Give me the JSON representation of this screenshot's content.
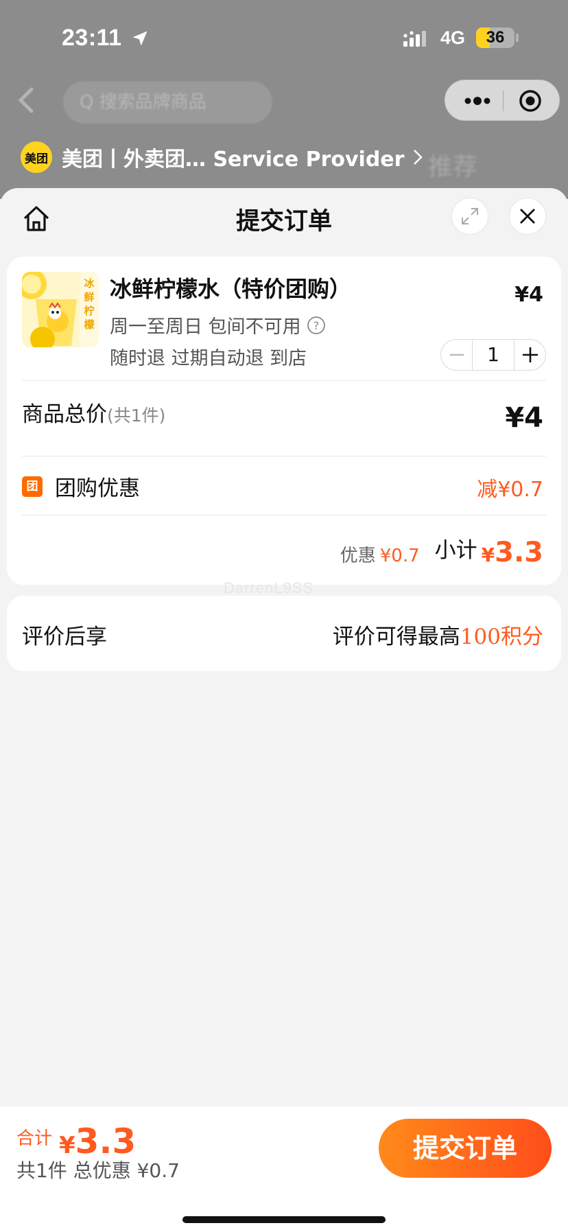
{
  "status_bar": {
    "time": "23:11",
    "network": "4G",
    "battery": "36",
    "battery_level": 0.36
  },
  "background_page": {
    "search_placeholder": "Q 搜索品牌商品",
    "blurred_tab": "推荐"
  },
  "provider_bar": {
    "logo_text": "美团",
    "text": "美团丨外卖团… Service Provider"
  },
  "sheet": {
    "title": "提交订单"
  },
  "product": {
    "name": "冰鲜柠檬水（特价团购）",
    "price": "¥4",
    "desc_line1": "周一至周日 包间不可用",
    "desc_line2": "随时退 过期自动退 到店",
    "quantity": "1",
    "thumb_label": "冰鲜柠檬"
  },
  "total": {
    "label": "商品总价",
    "count": "(共1件)",
    "price": "¥4"
  },
  "group_discount": {
    "icon_text": "团",
    "label": "团购优惠",
    "value": "减¥0.7"
  },
  "subtotal": {
    "discount_label": "优惠",
    "discount_value": "¥0.7",
    "label": "小计",
    "currency": "¥",
    "amount": "3.3"
  },
  "watermark": "DarrenL9SS",
  "review": {
    "label": "评价后享",
    "value_prefix": "评价可得最高",
    "points": "100积分"
  },
  "bottom_bar": {
    "sum_label": "合计",
    "currency": "¥",
    "sum_amount": "3.3",
    "summary": "共1件 总优惠 ¥0.7",
    "submit_label": "提交订单"
  },
  "colors": {
    "accent": "#ff5a1f",
    "brand_yellow": "#ffd21f",
    "button_gradient_start": "#ff8a1a",
    "button_gradient_end": "#ff4d1a"
  }
}
